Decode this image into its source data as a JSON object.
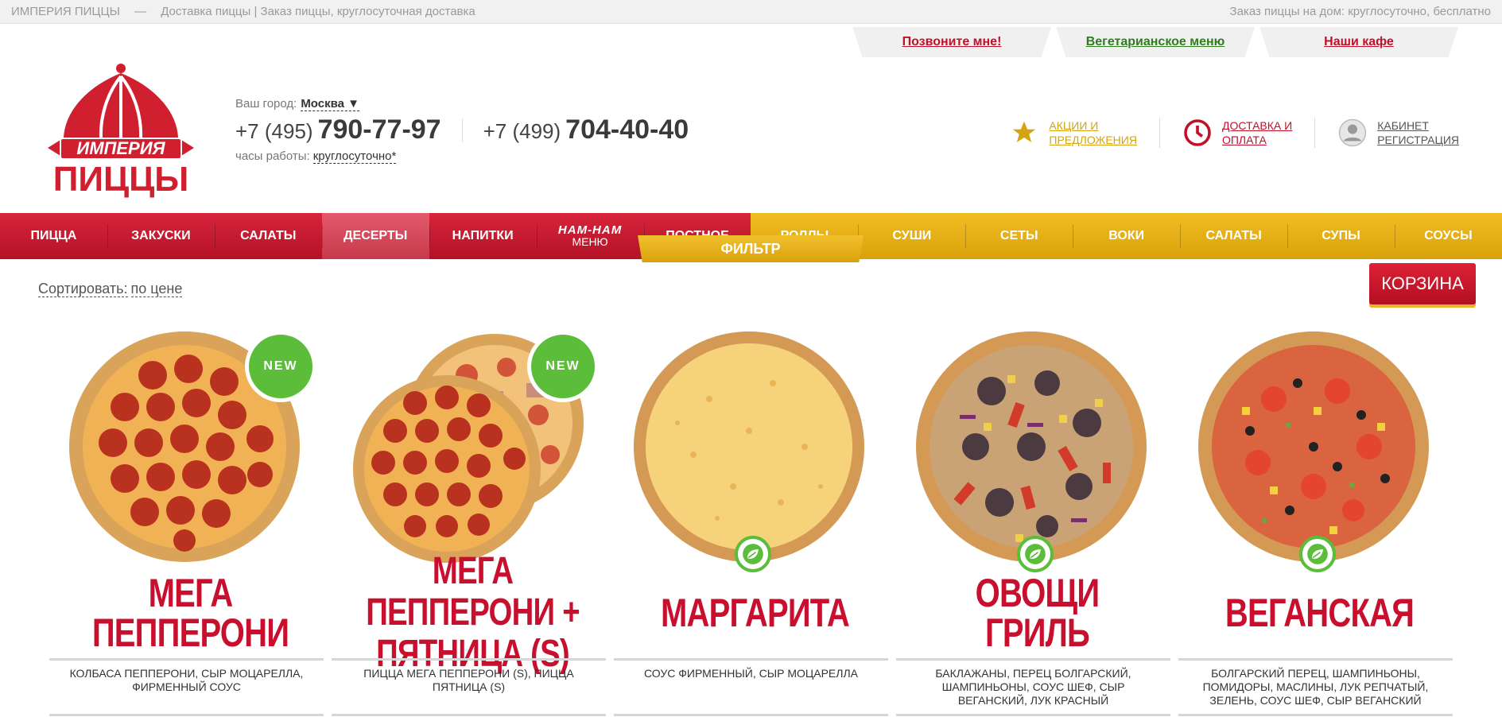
{
  "topbar": {
    "brand": "ИМПЕРИЯ ПИЦЦЫ",
    "dash": "—",
    "tagline": "Доставка пиццы | Заказ пиццы, круглосуточная доставка",
    "right": "Заказ пиццы на дом: круглосуточно, бесплатно"
  },
  "tabs": [
    {
      "label": "Позвоните мне!"
    },
    {
      "label": "Вегетарианское меню"
    },
    {
      "label": "Наши кафе"
    }
  ],
  "logo": {
    "line1": "ИМПЕРИЯ",
    "line2": "ПИЦЦЫ"
  },
  "city": {
    "label": "Ваш город:",
    "value": "Москва ▼"
  },
  "phones": [
    {
      "code": "+7 (495)",
      "number": "790-77-97"
    },
    {
      "code": "+7 (499)",
      "number": "704-40-40"
    }
  ],
  "hours": {
    "label": "часы работы:",
    "value": "круглосуточно*"
  },
  "quick_links": [
    {
      "line1": "Акции и",
      "line2": "предложения",
      "icon": "star-icon",
      "color": "#d4a411"
    },
    {
      "line1": "Доставка и",
      "line2": "оплата",
      "icon": "clock-icon",
      "color": "#c0112b"
    },
    {
      "line1": "Кабинет",
      "line2": "регистрация",
      "icon": "user-icon",
      "color": "#555555"
    }
  ],
  "nav": {
    "red_items": [
      "ПИЦЦА",
      "ЗАКУСКИ",
      "САЛАТЫ",
      "ДЕСЕРТЫ",
      "НАПИТКИ"
    ],
    "namnam": {
      "top": "НАМ-НАМ",
      "bottom": "меню"
    },
    "red_last": "ПОСТНОЕ",
    "yellow_items": [
      "РОЛЛЫ",
      "СУШИ",
      "СЕТЫ",
      "ВОКИ",
      "САЛАТЫ",
      "СУПЫ",
      "СОУСЫ"
    ]
  },
  "filter_label": "ФИЛЬТР",
  "sort": {
    "label": "Сортировать:",
    "value": "по цене"
  },
  "cart_label": "КОРЗИНА",
  "products": [
    {
      "name": "МЕГА ПЕППЕРОНИ",
      "desc": "КОЛБАСА ПЕППЕРОНИ, СЫР МОЦАРЕЛЛА, ФИРМЕННЫЙ СОУС",
      "badge": "NEW",
      "veg": false
    },
    {
      "name": "МЕГА ПЕППЕРОНИ + ПЯТНИЦА (S)",
      "desc": "ПИЦЦА МЕГА ПЕППЕРОНИ (S), ПИЦЦА ПЯТНИЦА (S)",
      "badge": "NEW",
      "veg": false
    },
    {
      "name": "МАРГАРИТА",
      "desc": "СОУС ФИРМЕННЫЙ, СЫР МОЦАРЕЛЛА",
      "badge": "",
      "veg": true
    },
    {
      "name": "ОВОЩИ ГРИЛЬ",
      "desc": "БАКЛАЖАНЫ, ПЕРЕЦ БОЛГАРСКИЙ, ШАМПИНЬОНЫ, СОУС ШЕФ, СЫР ВЕГАНСКИЙ, ЛУК КРАСНЫЙ",
      "badge": "",
      "veg": true
    },
    {
      "name": "ВЕГАНСКАЯ",
      "desc": "БОЛГАРСКИЙ ПЕРЕЦ, ШАМПИНЬОНЫ, ПОМИДОРЫ, МАСЛИНЫ, ЛУК РЕПЧАТЫЙ, ЗЕЛЕНЬ, СОУС ШЕФ, СЫР ВЕГАНСКИЙ",
      "badge": "",
      "veg": true
    }
  ]
}
